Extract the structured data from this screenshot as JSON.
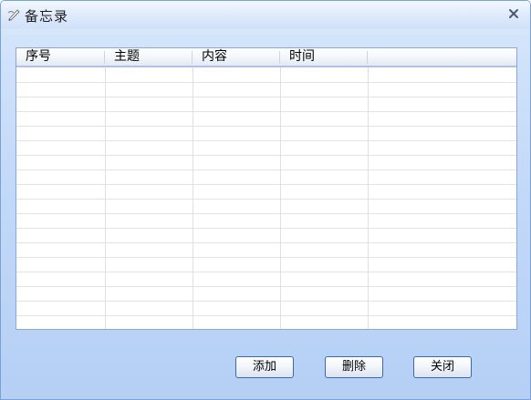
{
  "window": {
    "title": "备忘录",
    "icon": "pen-icon",
    "close_icon": "close-icon"
  },
  "listview": {
    "columns": [
      {
        "label": "序号"
      },
      {
        "label": "主题"
      },
      {
        "label": "内容"
      },
      {
        "label": "时间"
      },
      {
        "label": ""
      }
    ],
    "rows": []
  },
  "buttons": {
    "add_label": "添加",
    "delete_label": "删除",
    "close_label": "关闭"
  },
  "colors": {
    "window_border": "#7aa1d6",
    "button_border": "#3c6aa8",
    "list_border": "#8aa8d3"
  }
}
